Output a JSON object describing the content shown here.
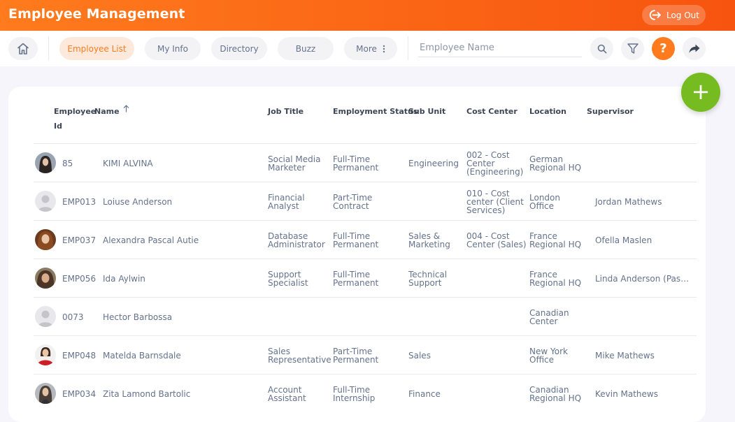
{
  "header": {
    "title": "Employee Management",
    "logout_label": "Log Out"
  },
  "nav": {
    "items": [
      "Employee List",
      "My Info",
      "Directory",
      "Buzz",
      "More"
    ],
    "search_placeholder": "Employee Name",
    "help_label": "?"
  },
  "table": {
    "headers": {
      "employee_id": [
        "Employee",
        "Id"
      ],
      "name": "Name",
      "job_title": "Job Title",
      "employment_status": "Employment Status",
      "sub_unit": "Sub Unit",
      "cost_center": "Cost Center",
      "location": "Location",
      "supervisor": "Supervisor"
    },
    "rows": [
      {
        "id": "85",
        "name": "KIMI ALVINA",
        "job": [
          "Social Media",
          "Marketer"
        ],
        "status": [
          "Full-Time",
          "Permanent"
        ],
        "sub": [
          "Engineering"
        ],
        "cost": [
          "002 - Cost",
          "Center",
          "(Engineering)"
        ],
        "location": [
          "German",
          "Regional HQ"
        ],
        "supervisor": "",
        "avatar": "photo-dark-hair"
      },
      {
        "id": "EMP013",
        "name": "Loiuse Anderson",
        "job": [
          "Financial",
          "Analyst"
        ],
        "status": [
          "Part-Time",
          "Contract"
        ],
        "sub": [],
        "cost": [
          "010 - Cost",
          "center (Client",
          "Services)"
        ],
        "location": [
          "London",
          "Office"
        ],
        "supervisor": "Jordan Mathews",
        "avatar": "placeholder"
      },
      {
        "id": "EMP037",
        "name": "Alexandra Pascal Autie",
        "job": [
          "Database",
          "Administrator"
        ],
        "status": [
          "Full-Time",
          "Permanent"
        ],
        "sub": [
          "Sales &",
          "Marketing"
        ],
        "cost": [
          "004 - Cost",
          "Center (Sales)"
        ],
        "location": [
          "France",
          "Regional HQ"
        ],
        "supervisor": "Ofella Maslen",
        "avatar": "photo-auburn-hair"
      },
      {
        "id": "EMP056",
        "name": "Ida Aylwin",
        "job": [
          "Support",
          "Specialist"
        ],
        "status": [
          "Full-Time",
          "Permanent"
        ],
        "sub": [
          "Technical",
          "Support"
        ],
        "cost": [],
        "location": [
          "France",
          "Regional HQ"
        ],
        "supervisor": "Linda Anderson (Pas…",
        "avatar": "photo-brown-hair"
      },
      {
        "id": "0073",
        "name": "Hector Barbossa",
        "job": [],
        "status": [],
        "sub": [],
        "cost": [],
        "location": [
          "Canadian",
          "Center"
        ],
        "supervisor": "",
        "avatar": "placeholder"
      },
      {
        "id": "EMP048",
        "name": "Matelda Barnsdale",
        "job": [
          "Sales",
          "Representative"
        ],
        "status": [
          "Part-Time",
          "Permanent"
        ],
        "sub": [
          "Sales"
        ],
        "cost": [],
        "location": [
          "New York",
          "Office"
        ],
        "supervisor": "Mike Mathews",
        "avatar": "photo-red-top"
      },
      {
        "id": "EMP034",
        "name": "Zita Lamond Bartolic",
        "job": [
          "Account",
          "Assistant"
        ],
        "status": [
          "Full-Time",
          "Internship"
        ],
        "sub": [
          "Finance"
        ],
        "cost": [],
        "location": [
          "Canadian",
          "Regional HQ"
        ],
        "supervisor": "Kevin Mathews",
        "avatar": "photo-long-hair"
      }
    ]
  },
  "colors": {
    "brand_orange": "#ff7b1d",
    "add_green": "#76bc21"
  }
}
